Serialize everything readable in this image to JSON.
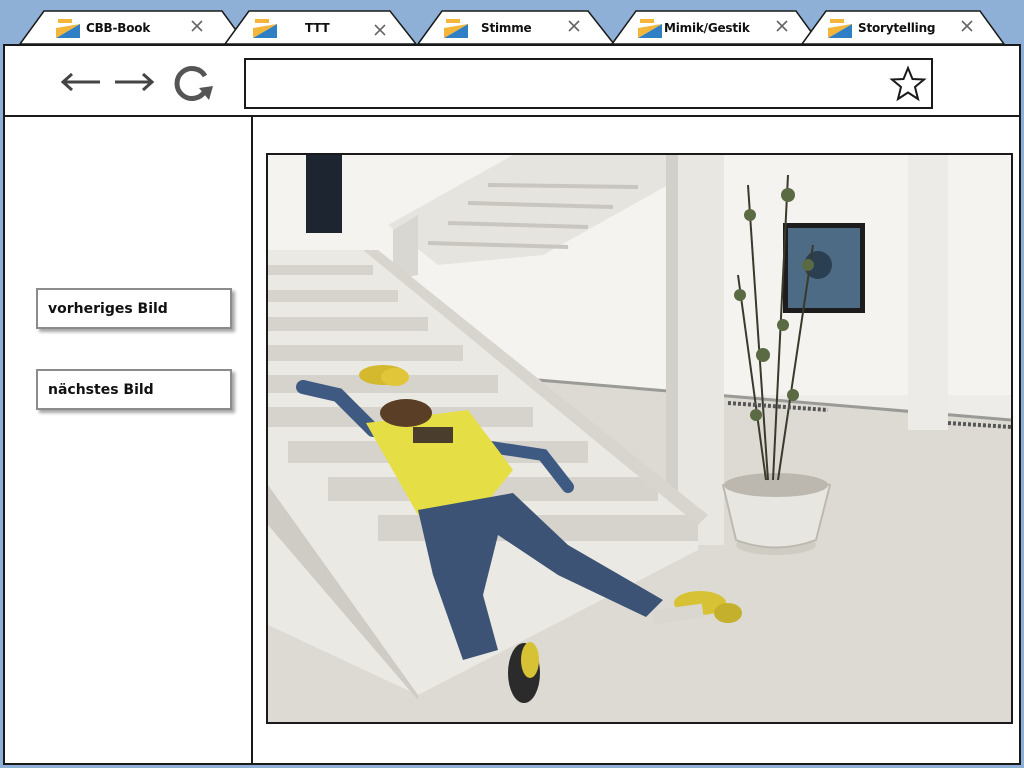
{
  "tabs": [
    {
      "label": "CBB-Book"
    },
    {
      "label": "TTT"
    },
    {
      "label": "Stimme"
    },
    {
      "label": "Mimik/Gestik"
    },
    {
      "label": "Storytelling"
    }
  ],
  "toolbar": {
    "back_icon": "left-arrow-icon",
    "forward_icon": "right-arrow-icon",
    "reload_icon": "reload-icon",
    "address_value": "",
    "bookmark_icon": "star-icon"
  },
  "sidebar": {
    "prev_label": "vorheriges Bild",
    "next_label": "nächstes Bild"
  },
  "colors": {
    "desktop": "#8fb0d6",
    "frame": "#1a1a1a",
    "button_border": "#8c8c8c"
  }
}
